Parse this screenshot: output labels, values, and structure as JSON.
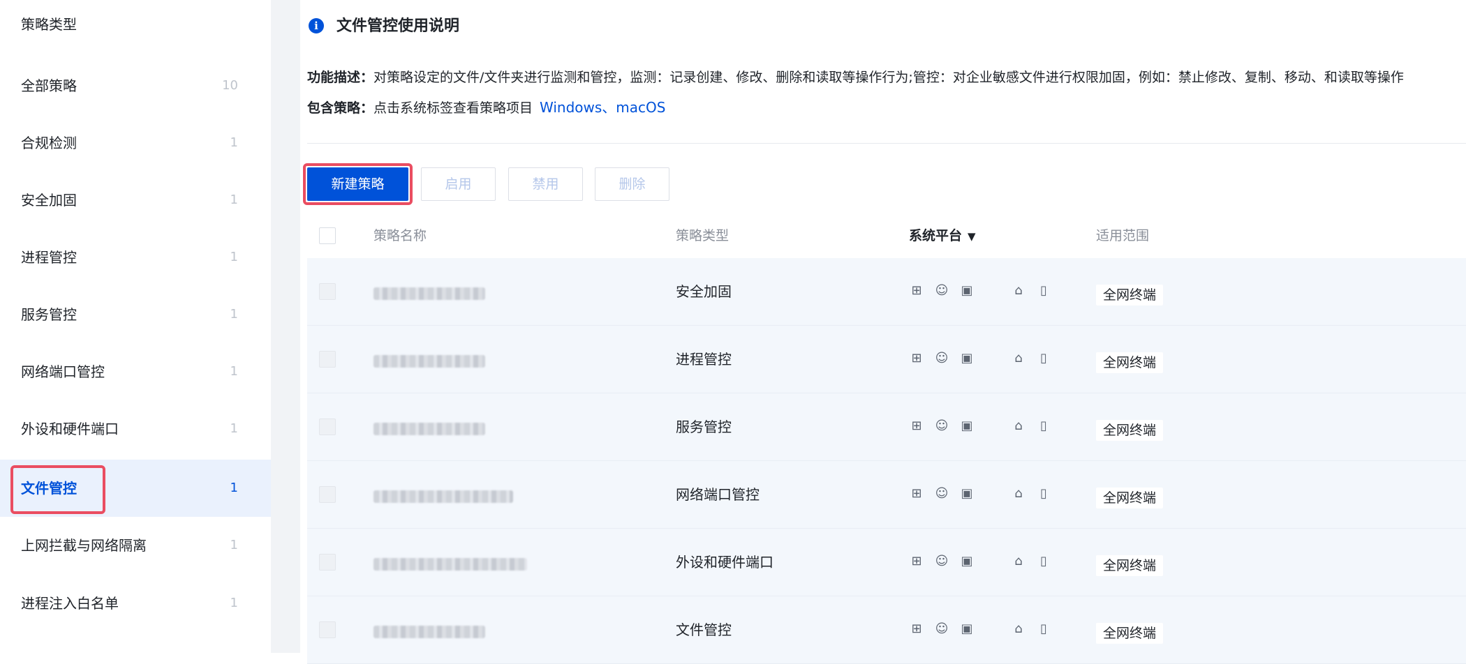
{
  "sidebar": {
    "title": "策略类型",
    "items": [
      {
        "label": "全部策略",
        "count": "10"
      },
      {
        "label": "合规检测",
        "count": "1"
      },
      {
        "label": "安全加固",
        "count": "1"
      },
      {
        "label": "进程管控",
        "count": "1"
      },
      {
        "label": "服务管控",
        "count": "1"
      },
      {
        "label": "网络端口管控",
        "count": "1"
      },
      {
        "label": "外设和硬件端口",
        "count": "1"
      },
      {
        "label": "文件管控",
        "count": "1",
        "active": true
      },
      {
        "label": "上网拦截与网络隔离",
        "count": "1"
      },
      {
        "label": "进程注入白名单",
        "count": "1"
      }
    ]
  },
  "header": {
    "info_icon": "i",
    "title": "文件管控使用说明",
    "desc_label": "功能描述：",
    "desc_text": "对策略设定的文件/文件夹进行监测和管控，监测：记录创建、修改、删除和读取等操作行为;管控：对企业敏感文件进行权限加固，例如：禁止修改、复制、移动、和读取等操作",
    "include_label": "包含策略：",
    "include_text": "点击系统标签查看策略项目",
    "include_link": "Windows、macOS"
  },
  "toolbar": {
    "new_label": "新建策略",
    "enable_label": "启用",
    "disable_label": "禁用",
    "delete_label": "删除"
  },
  "table": {
    "columns": {
      "name": "策略名称",
      "type": "策略类型",
      "platform": "系统平台",
      "scope": "适用范围"
    },
    "platform_icons": [
      "windows-icon",
      "macos-icon",
      "linux-icon",
      "android-icon",
      "ios-icon"
    ],
    "rows": [
      {
        "type": "安全加固",
        "scope": "全网终端"
      },
      {
        "type": "进程管控",
        "scope": "全网终端"
      },
      {
        "type": "服务管控",
        "scope": "全网终端"
      },
      {
        "type": "网络端口管控",
        "scope": "全网终端"
      },
      {
        "type": "外设和硬件端口",
        "scope": "全网终端"
      },
      {
        "type": "文件管控",
        "scope": "全网终端"
      }
    ]
  },
  "colors": {
    "accent": "#0052d9",
    "highlight": "#ea4d61",
    "row_bg": "#f3f7fc"
  }
}
